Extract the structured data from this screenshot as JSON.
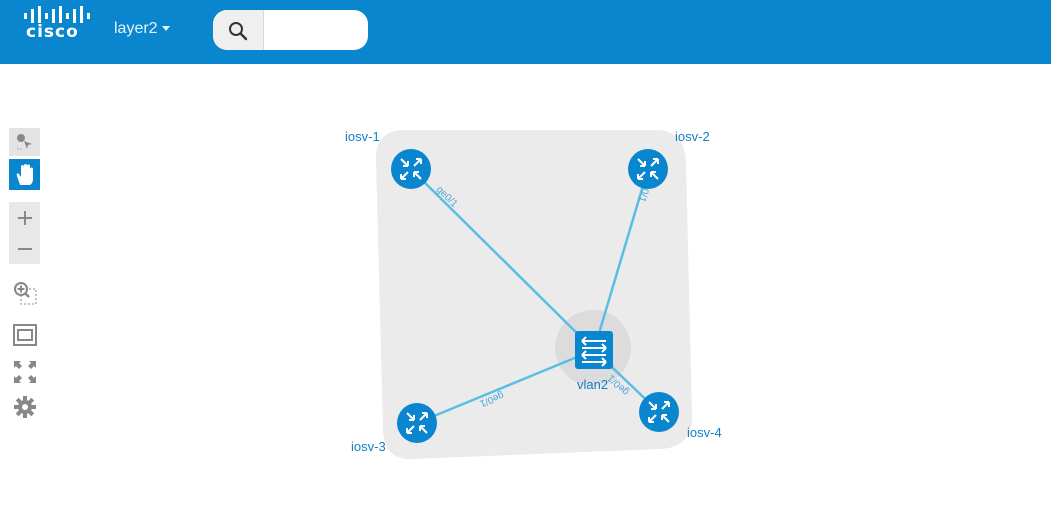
{
  "header": {
    "brand": "cisco",
    "topology_name": "layer2",
    "search": {
      "placeholder": "",
      "value": ""
    }
  },
  "toolbar": {
    "items": [
      "select-mode",
      "pan-mode",
      "zoom-in",
      "zoom-out",
      "zoom-by-selection",
      "fit-to-view",
      "fullscreen",
      "settings"
    ]
  },
  "topology": {
    "nodes": [
      {
        "id": "iosv-1",
        "label": "iosv-1",
        "type": "router"
      },
      {
        "id": "iosv-2",
        "label": "iosv-2",
        "type": "router"
      },
      {
        "id": "iosv-3",
        "label": "iosv-3",
        "type": "router"
      },
      {
        "id": "iosv-4",
        "label": "iosv-4",
        "type": "router"
      },
      {
        "id": "vlan2",
        "label": "vlan2",
        "type": "switch"
      }
    ],
    "links": [
      {
        "from": "iosv-1",
        "to": "vlan2",
        "label": "ge0/1"
      },
      {
        "from": "iosv-2",
        "to": "vlan2",
        "label": "ge0/1"
      },
      {
        "from": "iosv-3",
        "to": "vlan2",
        "label": "ge0/1"
      },
      {
        "from": "iosv-4",
        "to": "vlan2",
        "label": "ge0/1"
      }
    ]
  },
  "colors": {
    "header": "#0a86cf",
    "node": "#0a86cf",
    "link": "#5bbde4",
    "group": "#ebebeb"
  }
}
